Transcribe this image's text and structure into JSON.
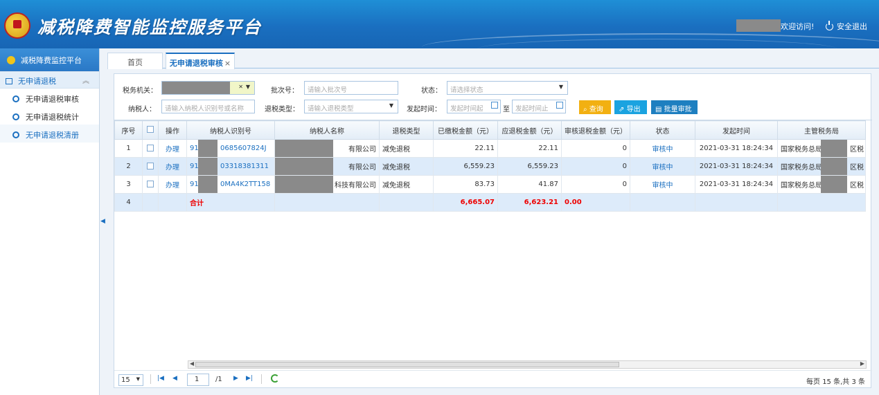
{
  "header": {
    "title": "减税降费智能监控服务平台",
    "welcome": "欢迎访问!",
    "logout": "安全退出"
  },
  "sidebar": {
    "title": "减税降费监控平台",
    "group": "无申请退税",
    "items": [
      {
        "label": "无申请退税审核"
      },
      {
        "label": "无申请退税统计"
      },
      {
        "label": "无申请退税清册"
      }
    ]
  },
  "tabs": {
    "home": "首页",
    "current": "无申请退税审核",
    "close": "×"
  },
  "filters": {
    "tax_office_label": "税务机关：",
    "batch_label": "批次号：",
    "batch_placeholder": "请输入批次号",
    "status_label": "状态：",
    "status_placeholder": "请选择状态",
    "taxpayer_label": "纳税人：",
    "taxpayer_placeholder": "请输入纳税人识别号或名称",
    "refund_type_label": "退税类型：",
    "refund_type_placeholder": "请输入退税类型",
    "time_label": "发起时间：",
    "time_start": "发起时间起",
    "time_to": "至",
    "time_end": "发起时间止",
    "query": "查询",
    "export": "导出",
    "batch_review": "批量审批"
  },
  "table": {
    "headers": [
      "序号",
      "",
      "操作",
      "纳税人识别号",
      "纳税人名称",
      "退税类型",
      "已缴税金额（元）",
      "应退税金额（元）",
      "审核退税金额（元）",
      "状态",
      "发起时间",
      "主管税务局"
    ],
    "rows": [
      {
        "no": "1",
        "op": "办理",
        "id_a": "91",
        "id_b": "0685607824J",
        "name": "有限公司",
        "type": "减免退税",
        "paid": "22.11",
        "refund": "22.11",
        "audit": "0",
        "status": "审核中",
        "time": "2021-03-31 18:24:34",
        "office_a": "国家税务总局",
        "office_b": "区税"
      },
      {
        "no": "2",
        "op": "办理",
        "id_a": "91",
        "id_b": "03318381311",
        "name": "有限公司",
        "type": "减免退税",
        "paid": "6,559.23",
        "refund": "6,559.23",
        "audit": "0",
        "status": "审核中",
        "time": "2021-03-31 18:24:34",
        "office_a": "国家税务总局",
        "office_b": "区税"
      },
      {
        "no": "3",
        "op": "办理",
        "id_a": "91",
        "id_b": "0MA4K2TT158",
        "name": "科技有限公司",
        "type": "减免退税",
        "paid": "83.73",
        "refund": "41.87",
        "audit": "0",
        "status": "审核中",
        "time": "2021-03-31 18:24:34",
        "office_a": "国家税务总局",
        "office_b": "区税"
      }
    ],
    "summary": {
      "no": "4",
      "label": "合计",
      "paid": "6,665.07",
      "refund": "6,623.21",
      "audit": "0.00"
    }
  },
  "pager": {
    "page_size": "15",
    "page": "1",
    "total_pages": "/1",
    "info": "每页 15 条,共 3 条"
  }
}
